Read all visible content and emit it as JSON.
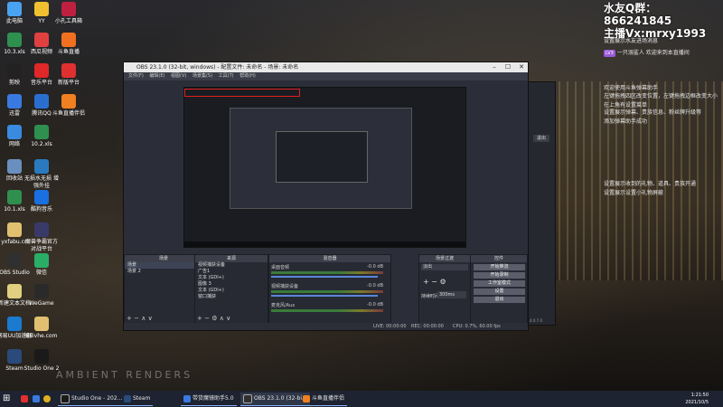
{
  "overlay": {
    "qq_line": "水友Q群：866241845",
    "anchor_line": "主播Vx:mrxy1993",
    "show_text": "设置展示水友进场消息",
    "user_badge": "LV3",
    "user_line": "一只溺鲨人 欢迎来到本直播间",
    "help_line1": "欢迎使用斗鱼弹幕助手",
    "help_line2": "左键拖拽四区改变位置，左键拖拽边框改变大小",
    "help_line3": "在上角有设置菜单",
    "help_line4": "设置展示弹幕、贵族信息、粉丝牌升级等",
    "help_line5": "添加弹幕助手成功",
    "gift_line1": "设置展示收到的礼物、道具、贵族开通",
    "gift_line2": "设置展示设置小礼物屏蔽"
  },
  "desktop_icons": [
    {
      "label": "此电脑",
      "color": "#4aa3f0"
    },
    {
      "label": "YY",
      "color": "#f0c030"
    },
    {
      "label": "小孔工具箱",
      "color": "#c02040"
    },
    {
      "label": "10.3.xls",
      "color": "#2f8f4f"
    },
    {
      "label": "西瓜视频",
      "color": "#e04040"
    },
    {
      "label": "斗鱼直播",
      "color": "#f07020"
    },
    {
      "label": "剪映",
      "color": "#222222"
    },
    {
      "label": "音乐平台",
      "color": "#e02828"
    },
    {
      "label": "新版平台",
      "color": "#e03030"
    },
    {
      "label": "迅雷",
      "color": "#3a7ae0"
    },
    {
      "label": "腾讯QQ",
      "color": "#2a6fd0"
    },
    {
      "label": "斗鱼直播伴侣",
      "color": "#f08020"
    },
    {
      "label": "网络",
      "color": "#3a8ae0"
    },
    {
      "label": "10.2.xls",
      "color": "#2f8f4f"
    },
    {
      "label": "回收站",
      "color": "#6a8fbf"
    },
    {
      "label": "无损水无损 增强外挂",
      "color": "#2a7ac0"
    },
    {
      "label": "10.1.xls",
      "color": "#2f8f4f"
    },
    {
      "label": "酷狗音乐",
      "color": "#1a70e0"
    },
    {
      "label": "yxfabu.cn",
      "color": "#e0c070"
    },
    {
      "label": "魔兽争霸官方对战平台",
      "color": "#3a3a6a"
    },
    {
      "label": "OBS Studio",
      "color": "#303030"
    },
    {
      "label": "微信",
      "color": "#2aae67"
    },
    {
      "label": "新建文本文档",
      "color": "#e0d080"
    },
    {
      "label": "WeGame",
      "color": "#2a2a2a"
    },
    {
      "label": "网易UU加速器",
      "color": "#1a7ad0"
    },
    {
      "label": "Bilivhe.com",
      "color": "#e0c070"
    },
    {
      "label": "Steam",
      "color": "#2a4a7a"
    },
    {
      "label": "Studio One 2",
      "color": "#1a1a1a"
    }
  ],
  "brand_text": "AMBIENT RENDERS",
  "obs": {
    "title": "OBS 23.1.0 (32-bit, windows) - 配置文件: 未命名 - 场景: 未命名",
    "menu": [
      "文件(F)",
      "编辑(E)",
      "视图(V)",
      "场景集(S)",
      "工具(T)",
      "帮助(H)"
    ],
    "scenes_header": "场景",
    "scenes": [
      "场景",
      "场景 2"
    ],
    "sources_header": "来源",
    "sources": [
      "视频捕获设备",
      "广告1",
      "文本 (GDI+)",
      "图像 3",
      "文本 (GDI+)",
      "窗口捕获"
    ],
    "mixer_header": "混音器",
    "mixer": [
      {
        "name": "桌面音频",
        "level": "-0.0 dB"
      },
      {
        "name": "视频捕获设备",
        "level": "-0.0 dB"
      },
      {
        "name": "麦克风/Aux",
        "level": "-0.0 dB"
      }
    ],
    "transitions_header": "场景过渡",
    "transition_type": "淡出",
    "duration_label": "持续时间",
    "duration_value": "300ms",
    "controls_header": "控件",
    "controls": [
      "开始推流",
      "开始录制",
      "工作室模式",
      "设置",
      "退出"
    ],
    "status": {
      "live": "LIVE: 00:00:00",
      "rec": "REC: 00:00:00",
      "cpu": "CPU: 0.7%, 60.00 fps"
    }
  },
  "side_panel": {
    "button": "退出",
    "version": "4.0.7.0"
  },
  "taskbar": {
    "apps": [
      {
        "label": "Studio One - 202...",
        "color": "#1a1a1a"
      },
      {
        "label": "Steam",
        "color": "#2a4a7a"
      },
      {
        "label": "带货魔镜助手5.0",
        "color": "#3a7ae0"
      },
      {
        "label": "OBS 23.1.0 (32-bi...",
        "color": "#303030"
      },
      {
        "label": "斗鱼直播伴侣",
        "color": "#f08020"
      }
    ],
    "time": "1:21:50",
    "date": "2021/10/5"
  }
}
